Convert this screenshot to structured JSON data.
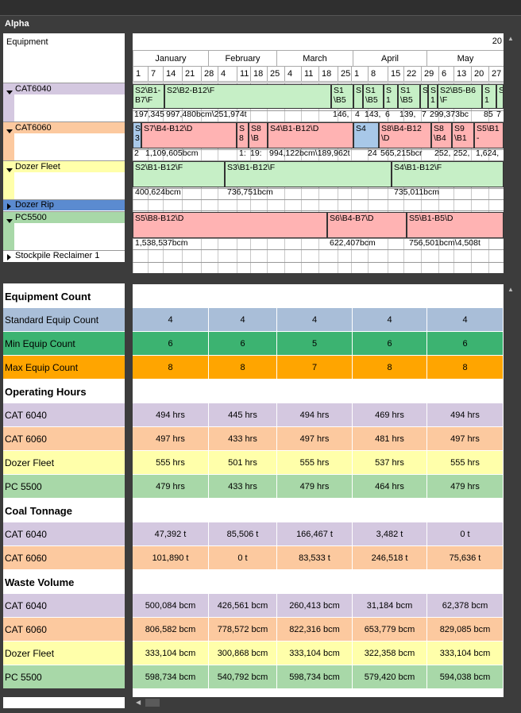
{
  "window": {
    "title": "Alpha"
  },
  "timeline": {
    "year_fragment": "20",
    "months": [
      "January",
      "February",
      "March",
      "April",
      "May"
    ],
    "days": [
      "1",
      "7",
      "14",
      "21",
      "28",
      "4",
      "11",
      "18",
      "25",
      "4",
      "11",
      "18",
      "25",
      "1",
      "8",
      "15",
      "22",
      "29",
      "6",
      "13",
      "20",
      "27"
    ]
  },
  "equipment_header": "Equipment",
  "equipment_rows": [
    {
      "label": "CAT6040",
      "expanded": true
    },
    {
      "label": "CAT6060",
      "expanded": true
    },
    {
      "label": "Dozer Fleet",
      "expanded": true
    },
    {
      "label": "Dozer Rip",
      "expanded": false
    },
    {
      "label": "PC5500",
      "expanded": true
    },
    {
      "label": "Stockpile Reclaimer 1",
      "expanded": false
    }
  ],
  "gantt": {
    "cat6040_bars": [
      "S2\\B1-B7\\F",
      "S2\\B2-B12\\F",
      "S1\\B5",
      "S",
      "S1\\B5",
      "S1",
      "S1\\B5",
      "S",
      "S1",
      "S2\\B5-B6\\F",
      "S1",
      "S"
    ],
    "cat6040_values": [
      "197,345",
      "997,480bcm\\251,974t",
      "146,",
      "4",
      "143,",
      "6",
      "139,",
      "7",
      "299,373bc",
      "85",
      "7"
    ],
    "cat6060_bars": [
      "S3",
      "S7\\B4-B12\\D",
      "S8",
      "S8\\B",
      "S4\\B1-B12\\D",
      "S4",
      "S8\\B4-B12\\D",
      "S8\\B4",
      "S9\\B1",
      "S5\\B1-"
    ],
    "cat6060_values": [
      "2",
      "1,109,605bcm",
      "1:",
      "19:",
      "994,122bcm\\189,962t",
      "24",
      "565,215bcr",
      "252,",
      "252,",
      "1,624,"
    ],
    "dozer_bars": [
      "S2\\B1-B12\\F",
      "S3\\B1-B12\\F",
      "S4\\B1-B12\\F"
    ],
    "dozer_values": [
      "400,624bcm",
      "736,751bcm",
      "735,011bcm"
    ],
    "pc_bars": [
      "S5\\B8-B12\\D",
      "S6\\B4-B7\\D",
      "S5\\B1-B5\\D"
    ],
    "pc_values": [
      "1,538,537bcm",
      "622,407bcm",
      "756,501bcm\\4,508t"
    ]
  },
  "summary": {
    "sections": [
      {
        "title": "Equipment Count",
        "rows": [
          {
            "label": "Standard Equip Count",
            "values": [
              "4",
              "4",
              "4",
              "4",
              "4"
            ]
          },
          {
            "label": "Min Equip Count",
            "values": [
              "6",
              "6",
              "5",
              "6",
              "6"
            ]
          },
          {
            "label": "Max Equip Count",
            "values": [
              "8",
              "8",
              "7",
              "8",
              "8"
            ]
          }
        ]
      },
      {
        "title": "Operating Hours",
        "rows": [
          {
            "label": "CAT 6040",
            "values": [
              "494 hrs",
              "445 hrs",
              "494 hrs",
              "469 hrs",
              "494 hrs"
            ]
          },
          {
            "label": "CAT 6060",
            "values": [
              "497 hrs",
              "433 hrs",
              "497 hrs",
              "481 hrs",
              "497 hrs"
            ]
          },
          {
            "label": "Dozer Fleet",
            "values": [
              "555 hrs",
              "501 hrs",
              "555 hrs",
              "537 hrs",
              "555 hrs"
            ]
          },
          {
            "label": "PC 5500",
            "values": [
              "479 hrs",
              "433 hrs",
              "479 hrs",
              "464 hrs",
              "479 hrs"
            ]
          }
        ]
      },
      {
        "title": "Coal Tonnage",
        "rows": [
          {
            "label": "CAT 6040",
            "values": [
              "47,392 t",
              "85,506 t",
              "166,467 t",
              "3,482 t",
              "0 t"
            ]
          },
          {
            "label": "CAT 6060",
            "values": [
              "101,890 t",
              "0 t",
              "83,533 t",
              "246,518 t",
              "75,636 t"
            ]
          }
        ]
      },
      {
        "title": "Waste Volume",
        "rows": [
          {
            "label": "CAT 6040",
            "values": [
              "500,084 bcm",
              "426,561 bcm",
              "260,413 bcm",
              "31,184 bcm",
              "62,378 bcm"
            ]
          },
          {
            "label": "CAT 6060",
            "values": [
              "806,582 bcm",
              "778,572 bcm",
              "822,316 bcm",
              "653,779 bcm",
              "829,085 bcm"
            ]
          },
          {
            "label": "Dozer Fleet",
            "values": [
              "333,104 bcm",
              "300,868 bcm",
              "333,104 bcm",
              "322,358 bcm",
              "333,104 bcm"
            ]
          },
          {
            "label": "PC 5500",
            "values": [
              "598,734 bcm",
              "540,792 bcm",
              "598,734 bcm",
              "579,420 bcm",
              "594,038 bcm"
            ]
          }
        ]
      }
    ]
  },
  "colors": {
    "cat6040": "#d4c8e0",
    "cat6060": "#fcc99f",
    "dozer": "#ffffaa",
    "pc5500": "#a8d8a8",
    "standard": "#a9bed8",
    "min": "#3cb371",
    "max": "#ffa500"
  }
}
